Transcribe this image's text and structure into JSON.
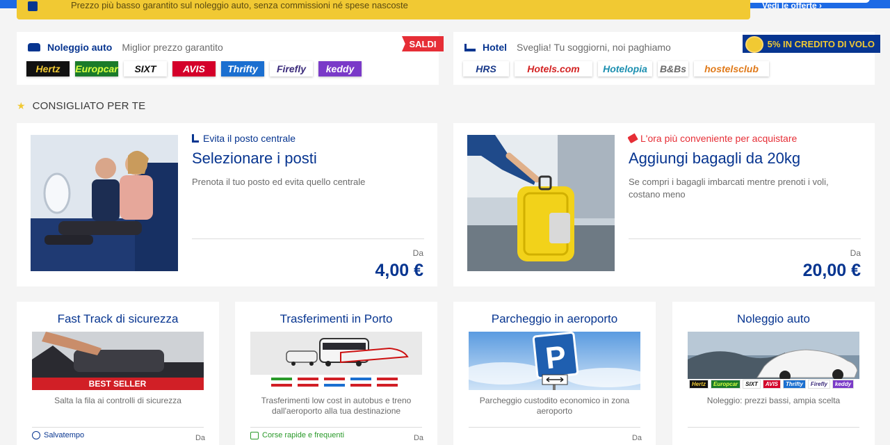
{
  "promo": {
    "text": "Prezzo più basso garantito sul noleggio auto, senza commissioni né spese nascoste",
    "right_link": "Vedi le offerte ›"
  },
  "car_rental": {
    "title": "Noleggio auto",
    "subtitle": "Miglior prezzo garantito",
    "sale_badge": "SALDI",
    "logos": [
      {
        "name": "Hertz",
        "bg": "#111111",
        "fg": "#f1c933"
      },
      {
        "name": "Europcar",
        "bg": "#1a7a2a",
        "fg": "#d8ff40"
      },
      {
        "name": "SIXT",
        "bg": "#ffffff",
        "fg": "#111111"
      },
      {
        "name": "AVIS",
        "bg": "#d4002a",
        "fg": "#ffffff"
      },
      {
        "name": "Thrifty",
        "bg": "#1b6fd0",
        "fg": "#ffffff"
      },
      {
        "name": "Firefly",
        "bg": "#ffffff",
        "fg": "#3a2a7a"
      },
      {
        "name": "keddy",
        "bg": "#7a3ac8",
        "fg": "#ffffff"
      }
    ]
  },
  "hotel": {
    "title": "Hotel",
    "subtitle": "Sveglia! Tu soggiorni, noi paghiamo",
    "credit_badge": "5% IN CREDITO DI VOLO",
    "logos": [
      {
        "name": "HRS",
        "bg": "#ffffff",
        "fg": "#1a3a8a"
      },
      {
        "name": "Hotels.com",
        "bg": "#ffffff",
        "fg": "#d32323"
      },
      {
        "name": "Hotelopia",
        "bg": "#ffffff",
        "fg": "#1b8fb0"
      },
      {
        "name": "B&Bs",
        "bg": "#ffffff",
        "fg": "#6a6a6a"
      },
      {
        "name": "hostelsclub",
        "bg": "#ffffff",
        "fg": "#e07a1a"
      }
    ]
  },
  "section": {
    "title": "CONSIGLIATO PER TE"
  },
  "recommendations": [
    {
      "tag": "Evita il posto centrale",
      "tag_color": "#073590",
      "title": "Selezionare i posti",
      "description": "Prenota il tuo posto ed evita quello centrale",
      "from_label": "Da",
      "price": "4,00 €"
    },
    {
      "tag": "L'ora più conveniente per acquistare",
      "tag_color": "#e62e36",
      "title": "Aggiungi bagagli da 20kg",
      "description": "Se compri i bagagli imbarcati mentre prenoti i voli, costano meno",
      "from_label": "Da",
      "price": "20,00 €"
    }
  ],
  "services": [
    {
      "title": "Fast Track di sicurezza",
      "image_label": "BEST SELLER",
      "description": "Salta la fila ai controlli di sicurezza",
      "badge": "Salvatempo",
      "badge_color": "#073590",
      "from_label": "Da"
    },
    {
      "title": "Trasferimenti in Porto",
      "description": "Trasferimenti low cost in autobus e treno dall'aeroporto alla tua destinazione",
      "badge": "Corse rapide e frequenti",
      "badge_color": "#2a9a2a",
      "from_label": "Da"
    },
    {
      "title": "Parcheggio in aeroporto",
      "image_label": "P",
      "description": "Parcheggio custodito economico in zona aeroporto",
      "from_label": "Da"
    },
    {
      "title": "Noleggio auto",
      "description": "Noleggio: prezzi bassi, ampia scelta",
      "logos": [
        "Hertz",
        "Europcar",
        "SIXT",
        "AVIS",
        "Thrifty",
        "Firefly",
        "keddy"
      ]
    }
  ]
}
